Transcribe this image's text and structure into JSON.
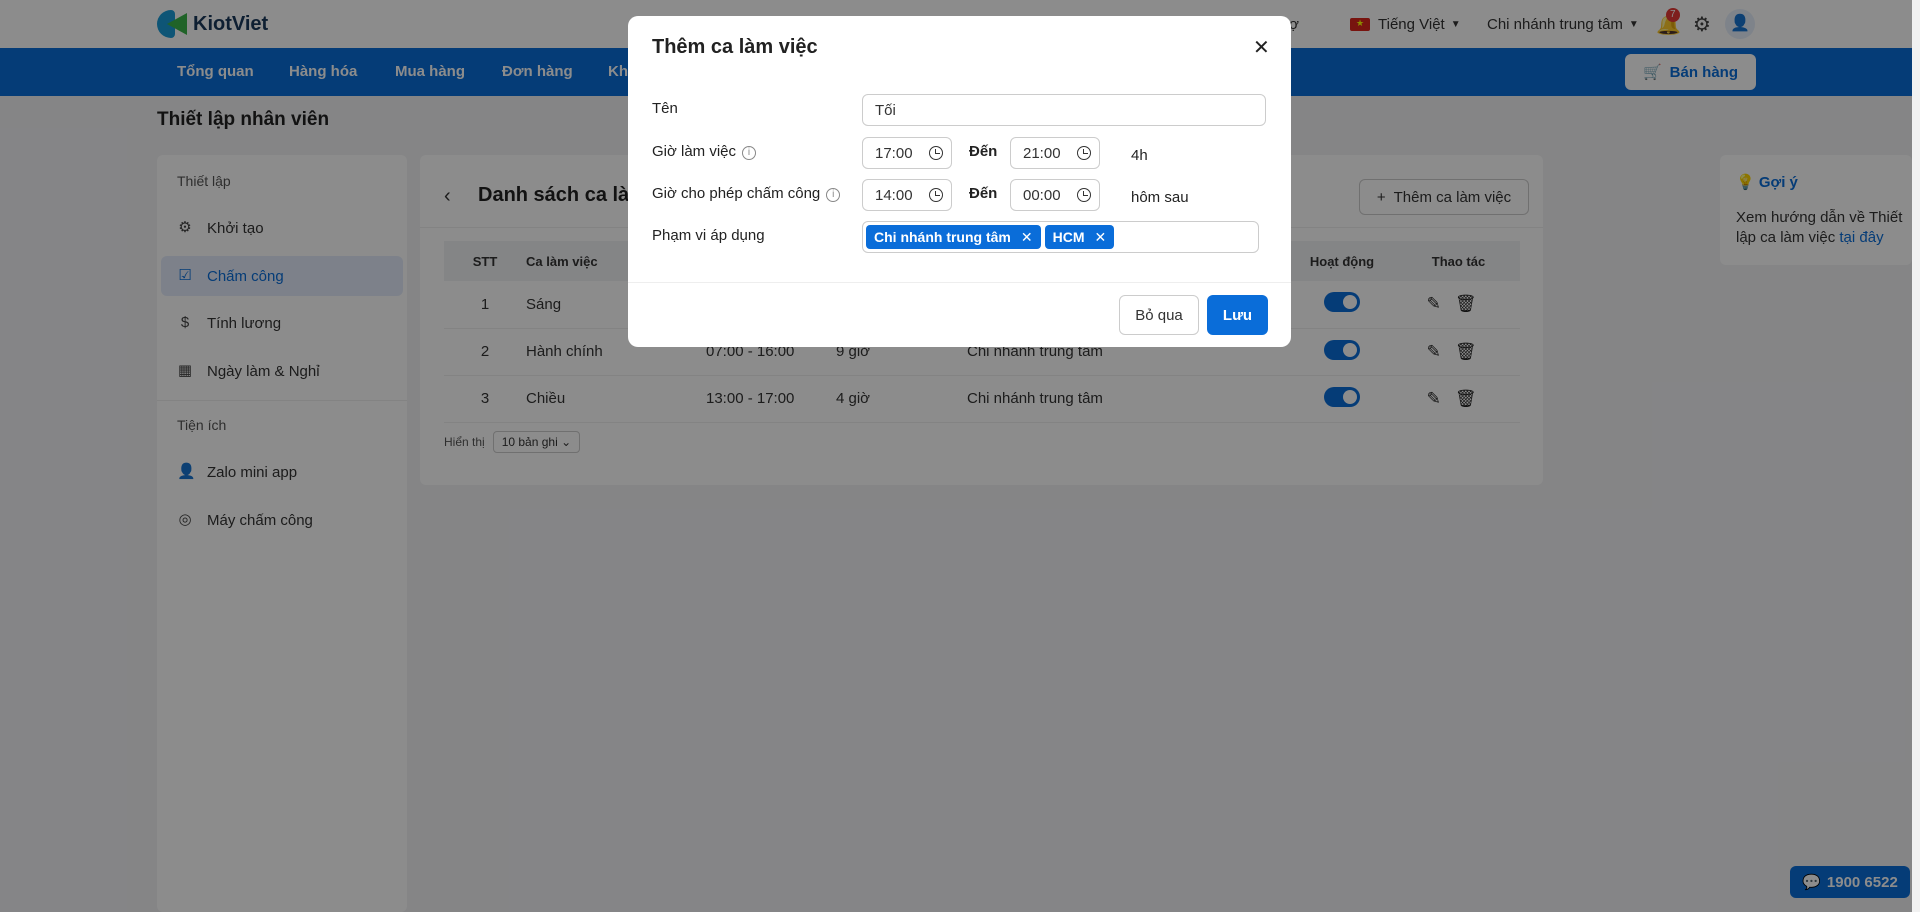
{
  "app": {
    "logo_text": "KiotViet"
  },
  "topbar": {
    "support": "trợ",
    "language": "Tiếng Việt",
    "branch": "Chi nhánh trung tâm",
    "notification_count": "7"
  },
  "nav": {
    "items": [
      "Tổng quan",
      "Hàng hóa",
      "Mua hàng",
      "Đơn hàng",
      "Khá"
    ],
    "sell_label": "Bán hàng"
  },
  "page": {
    "title": "Thiết lập nhân viên"
  },
  "sidebar": {
    "section1": "Thiết lập",
    "items": [
      {
        "label": "Khởi tạo",
        "icon": "gear-icon"
      },
      {
        "label": "Chấm công",
        "icon": "calendar-check-icon"
      },
      {
        "label": "Tính lương",
        "icon": "dollar-icon"
      },
      {
        "label": "Ngày làm & Nghỉ",
        "icon": "calendar-icon"
      }
    ],
    "section2": "Tiện ích",
    "items2": [
      {
        "label": "Zalo mini app",
        "icon": "user-icon"
      },
      {
        "label": "Máy chấm công",
        "icon": "fingerprint-icon"
      }
    ]
  },
  "main": {
    "title": "Danh sách ca làm",
    "add_label": "Thêm ca làm việc",
    "columns": [
      "STT",
      "Ca làm việc",
      "Hoạt động",
      "Thao tác"
    ],
    "rows": [
      {
        "stt": "1",
        "name": "Sáng",
        "time": "",
        "hours": "",
        "branch": "",
        "active": true
      },
      {
        "stt": "2",
        "name": "Hành chính",
        "time": "07:00 - 16:00",
        "hours": "9 giờ",
        "branch": "Chi nhánh trung tâm",
        "active": true
      },
      {
        "stt": "3",
        "name": "Chiều",
        "time": "13:00 - 17:00",
        "hours": "4 giờ",
        "branch": "Chi nhánh trung tâm",
        "active": true
      }
    ],
    "paging_label": "Hiển thị",
    "paging_value": "10 bản ghi"
  },
  "hint": {
    "title": "Gợi ý",
    "text": "Xem hướng dẫn về Thiết lập ca làm việc ",
    "link": "tại đây"
  },
  "hotline": "1900 6522",
  "modal": {
    "title": "Thêm ca làm việc",
    "name_label": "Tên",
    "name_value": "Tối",
    "work_time_label": "Giờ làm việc",
    "work_from": "17:00",
    "to_label": "Đến",
    "work_to": "21:00",
    "duration": "4h",
    "checkin_label": "Giờ cho phép chấm công",
    "checkin_from": "14:00",
    "checkin_to": "00:00",
    "next_day": "hôm sau",
    "scope_label": "Phạm vi áp dụng",
    "scope_tags": [
      "Chi nhánh trung tâm",
      "HCM"
    ],
    "skip_label": "Bỏ qua",
    "save_label": "Lưu"
  },
  "colors": {
    "primary": "#0a6dd9",
    "overlay": "rgba(0,0,0,0.45)"
  }
}
